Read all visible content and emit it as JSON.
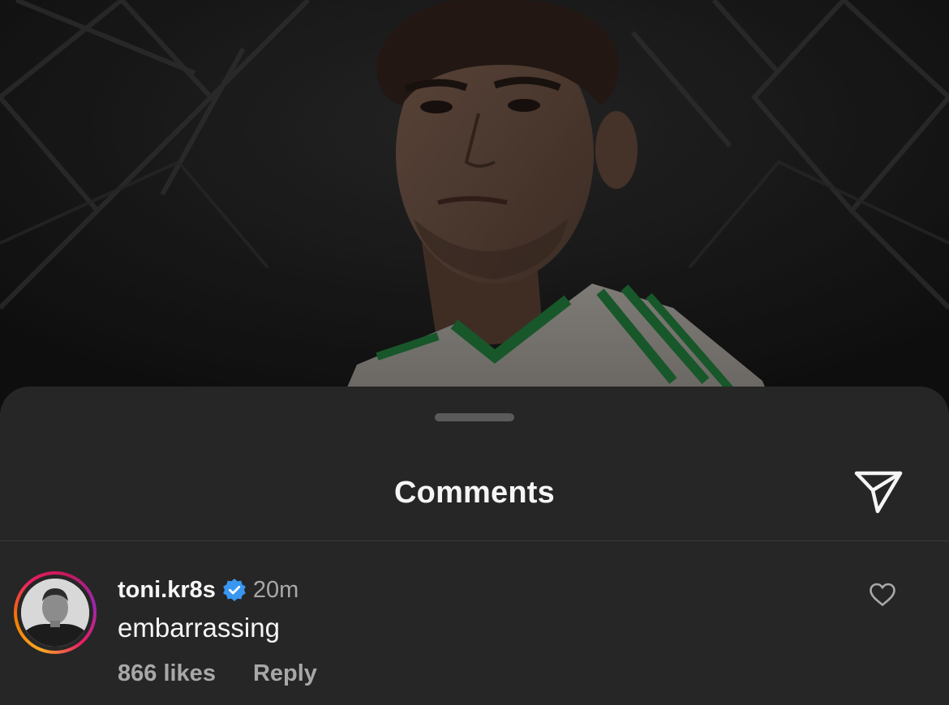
{
  "sheet": {
    "title": "Comments",
    "share_icon": "paper-plane-icon"
  },
  "comment": {
    "username": "toni.kr8s",
    "verified": true,
    "time": "20m",
    "text": "embarrassing",
    "likes": "866 likes",
    "reply_label": "Reply",
    "like_icon": "heart-outline-icon",
    "avatar_icon": "user-avatar"
  },
  "colors": {
    "sheet_background": "#262626",
    "primary_text": "#f5f5f5",
    "secondary_text": "#a8a8a8",
    "verified_blue": "#3897f0"
  }
}
